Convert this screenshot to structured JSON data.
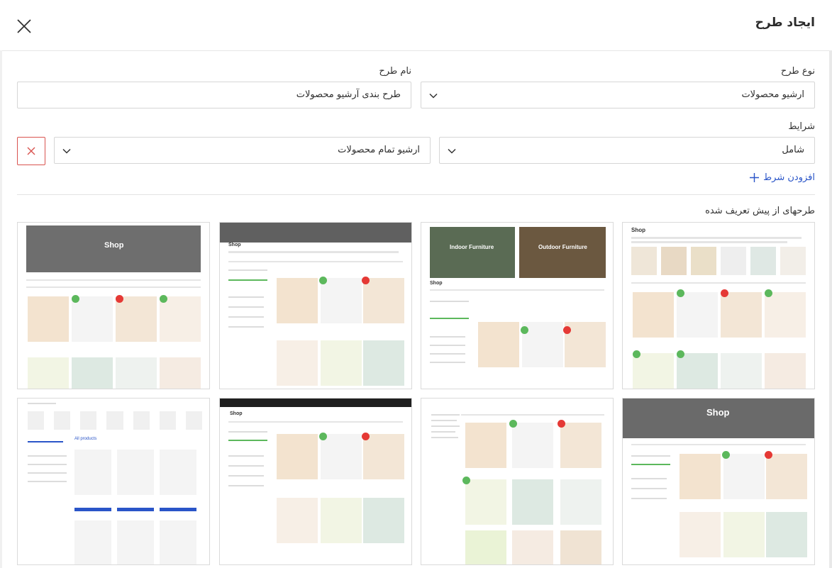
{
  "dialog": {
    "title": "ایجاد طرح"
  },
  "form": {
    "type_label": "نوع طرح",
    "type_value": "ارشیو محصولات",
    "name_label": "نام طرح",
    "name_value": "طرح بندی آرشیو محصولات",
    "conditions_label": "شرایط",
    "condition_mode": "شامل",
    "condition_target": "ارشیو تمام محصولات",
    "add_condition_label": "افزودن شرط"
  },
  "templates": {
    "section_title": "طرحهای از پیش تعریف شده",
    "items": [
      {
        "hero": "Shop"
      },
      {
        "hero": "Shop"
      },
      {
        "hero": "Indoor Furniture",
        "hero2": "Outdoor Furniture",
        "heading": "Shop"
      },
      {
        "hero": "Shop"
      },
      {
        "hero": "All products"
      },
      {
        "hero": "Shop"
      },
      {
        "hero": ""
      },
      {
        "hero": "Shop"
      }
    ]
  },
  "colors": {
    "accent": "#2a55c8",
    "danger": "#d9534f",
    "badge_green": "#5cb85c",
    "badge_red": "#e53935"
  }
}
